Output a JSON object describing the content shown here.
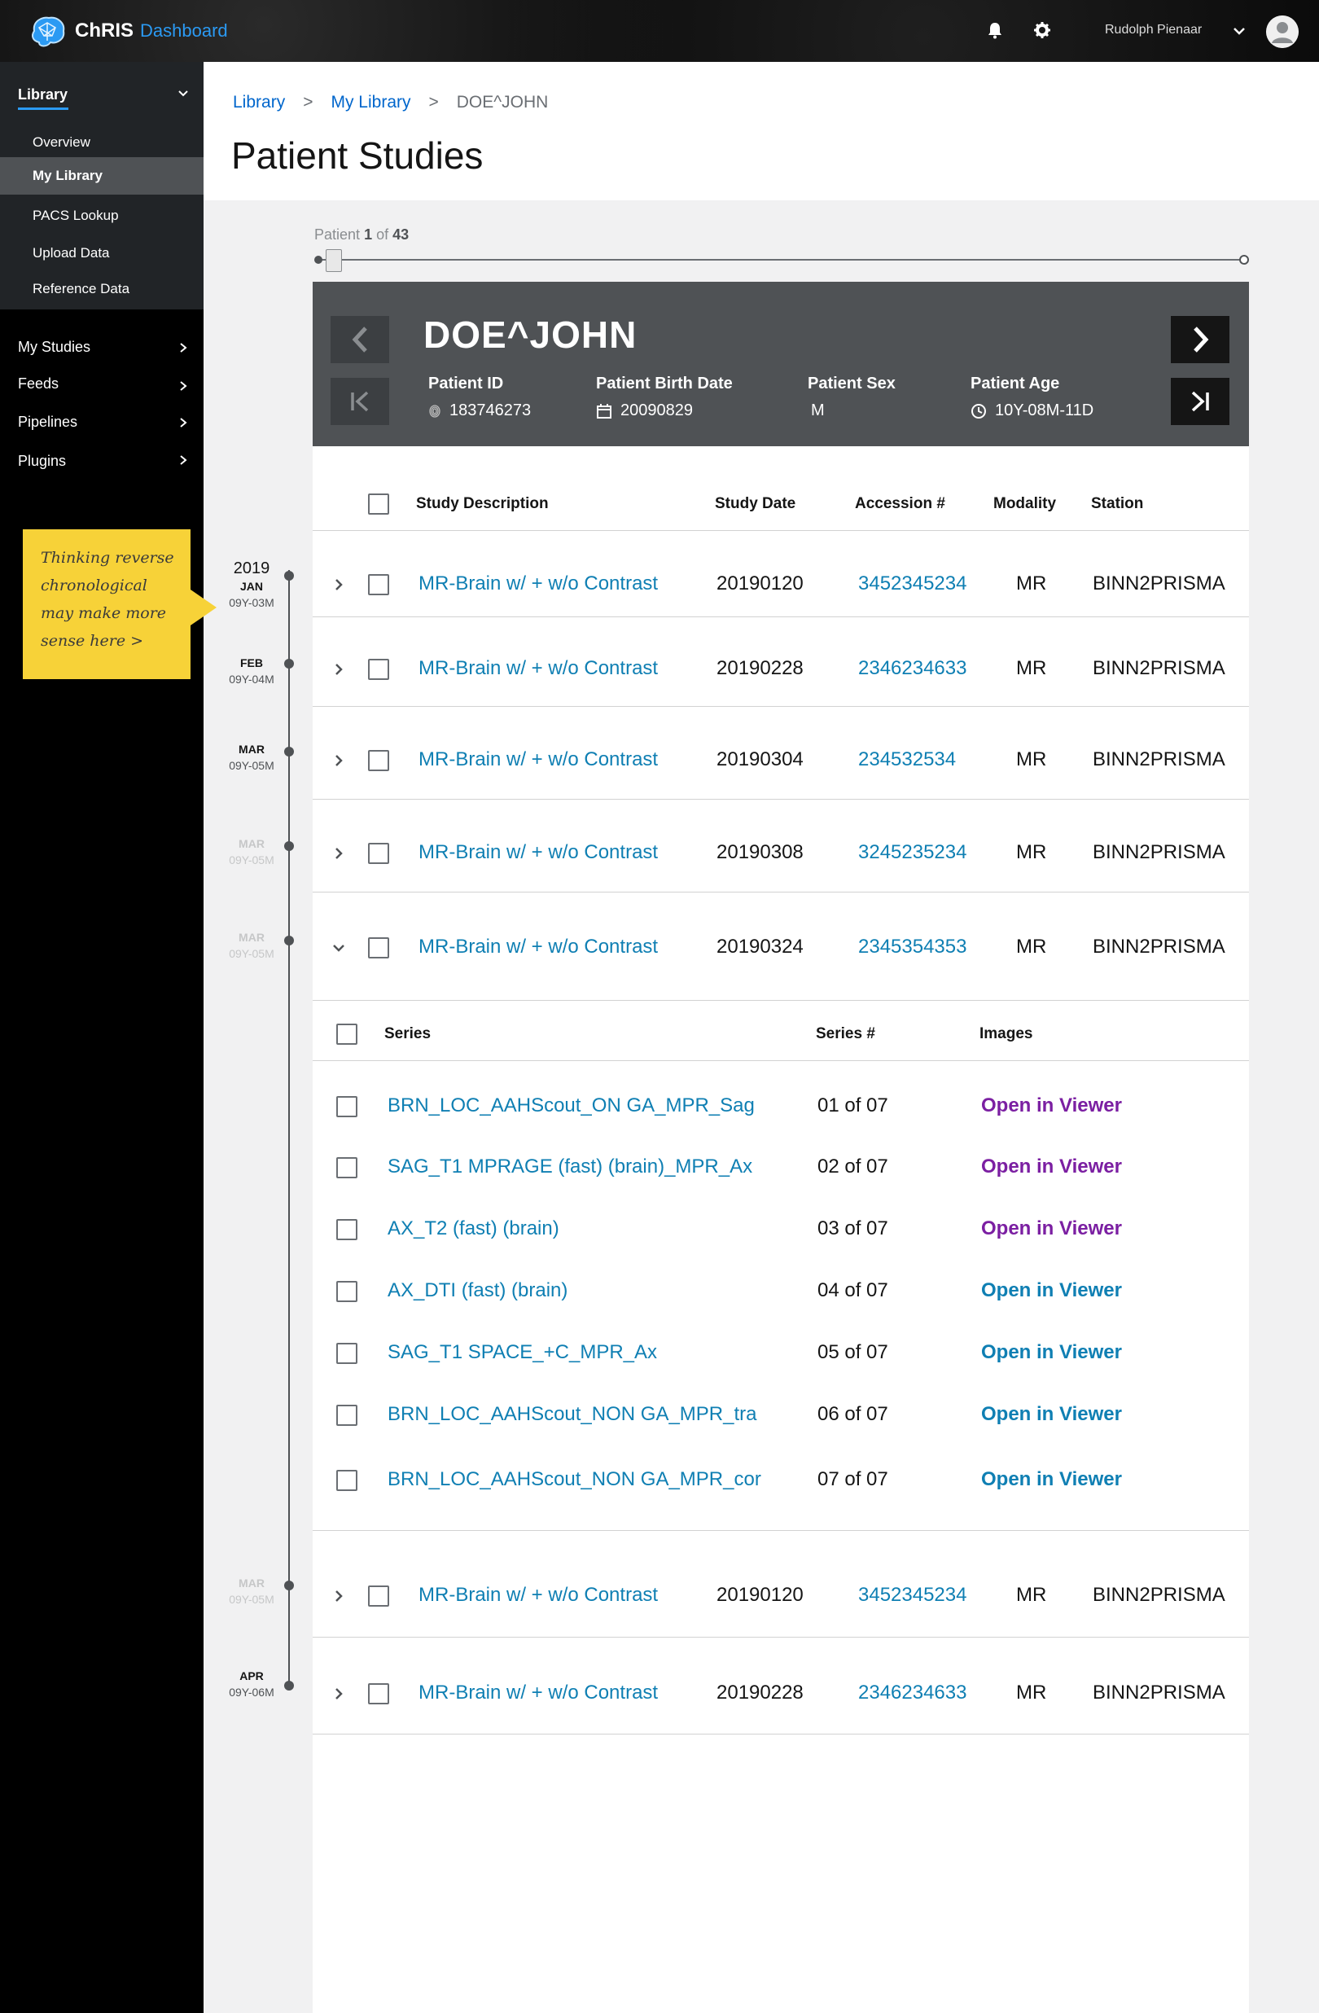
{
  "app": {
    "name": "ChRIS",
    "subtitle": "Dashboard"
  },
  "header_bar": {
    "user_name": "Rudolph Pienaar"
  },
  "sidebar": {
    "library": {
      "label": "Library",
      "items": [
        "Overview",
        "My Library",
        "PACS Lookup",
        "Upload Data",
        "Reference Data"
      ],
      "active": "My Library"
    },
    "sections": [
      "My Studies",
      "Feeds",
      "Pipelines",
      "Plugins"
    ]
  },
  "note": {
    "lines": [
      "Thinking reverse",
      "chronological",
      "may make more",
      "sense here >"
    ]
  },
  "breadcrumb": {
    "items": [
      "Library",
      "My Library",
      "DOE^JOHN"
    ],
    "separator": ">"
  },
  "page_title": "Patient Studies",
  "patient_counter": {
    "prefix": "Patient",
    "current": "1",
    "of_text": "of",
    "total": "43"
  },
  "patient": {
    "name": "DOE^JOHN",
    "fields": [
      {
        "label": "Patient ID",
        "value": "183746273",
        "icon": "fingerprint-icon"
      },
      {
        "label": "Patient Birth Date",
        "value": "20090829",
        "icon": "calendar-icon"
      },
      {
        "label": "Patient Sex",
        "value": "M",
        "icon": ""
      },
      {
        "label": "Patient Age",
        "value": "10Y-08M-11D",
        "icon": "clock-icon"
      }
    ]
  },
  "studies_table": {
    "columns": [
      "Study Description",
      "Study Date",
      "Accession #",
      "Modality",
      "Station"
    ],
    "rows": [
      {
        "description": "MR-Brain w/ + w/o Contrast",
        "date": "20190120",
        "accession": "3452345234",
        "modality": "MR",
        "station": "BINN2PRISMA",
        "expanded": false
      },
      {
        "description": "MR-Brain w/ + w/o Contrast",
        "date": "20190228",
        "accession": "2346234633",
        "modality": "MR",
        "station": "BINN2PRISMA",
        "expanded": false
      },
      {
        "description": "MR-Brain w/ + w/o Contrast",
        "date": "20190304",
        "accession": "234532534",
        "modality": "MR",
        "station": "BINN2PRISMA",
        "expanded": false
      },
      {
        "description": "MR-Brain w/ + w/o Contrast",
        "date": "20190308",
        "accession": "3245235234",
        "modality": "MR",
        "station": "BINN2PRISMA",
        "expanded": false
      },
      {
        "description": "MR-Brain w/ + w/o Contrast",
        "date": "20190324",
        "accession": "2345354353",
        "modality": "MR",
        "station": "BINN2PRISMA",
        "expanded": true
      },
      {
        "description": "MR-Brain w/ + w/o Contrast",
        "date": "20190120",
        "accession": "3452345234",
        "modality": "MR",
        "station": "BINN2PRISMA",
        "expanded": false
      },
      {
        "description": "MR-Brain w/ + w/o Contrast",
        "date": "20190228",
        "accession": "2346234633",
        "modality": "MR",
        "station": "BINN2PRISMA",
        "expanded": false
      }
    ]
  },
  "series_table": {
    "columns": [
      "Series",
      "Series #",
      "Images"
    ],
    "rows": [
      {
        "name": "BRN_LOC_AAHScout_ON GA_MPR_Sag",
        "number": "01 of 07",
        "action": "Open in Viewer",
        "visited": true
      },
      {
        "name": "SAG_T1 MPRAGE (fast) (brain)_MPR_Ax",
        "number": "02 of 07",
        "action": "Open in Viewer",
        "visited": true
      },
      {
        "name": "AX_T2 (fast) (brain)",
        "number": "03 of 07",
        "action": "Open in Viewer",
        "visited": true
      },
      {
        "name": "AX_DTI (fast) (brain)",
        "number": "04 of 07",
        "action": "Open in Viewer",
        "visited": false
      },
      {
        "name": "SAG_T1 SPACE_+C_MPR_Ax",
        "number": "05 of 07",
        "action": "Open in Viewer",
        "visited": false
      },
      {
        "name": "BRN_LOC_AAHScout_NON GA_MPR_tra",
        "number": "06 of 07",
        "action": "Open in Viewer",
        "visited": false
      },
      {
        "name": "BRN_LOC_AAHScout_NON GA_MPR_cor",
        "number": "07 of 07",
        "action": "Open in Viewer",
        "visited": false
      }
    ]
  },
  "timeline": [
    {
      "year": "2019",
      "month": "JAN",
      "age": "09Y-03M",
      "faded": false
    },
    {
      "year": "",
      "month": "FEB",
      "age": "09Y-04M",
      "faded": false
    },
    {
      "year": "",
      "month": "MAR",
      "age": "09Y-05M",
      "faded": false
    },
    {
      "year": "",
      "month": "MAR",
      "age": "09Y-05M",
      "faded": true
    },
    {
      "year": "",
      "month": "MAR",
      "age": "09Y-05M",
      "faded": true
    },
    {
      "year": "",
      "month": "MAR",
      "age": "09Y-05M",
      "faded": true
    },
    {
      "year": "",
      "month": "APR",
      "age": "09Y-06M",
      "faded": false
    }
  ],
  "colors": {
    "link": "#0f7fb3",
    "visited": "#7b1fa2",
    "accent": "#2b9af3",
    "note": "#f7d238"
  }
}
